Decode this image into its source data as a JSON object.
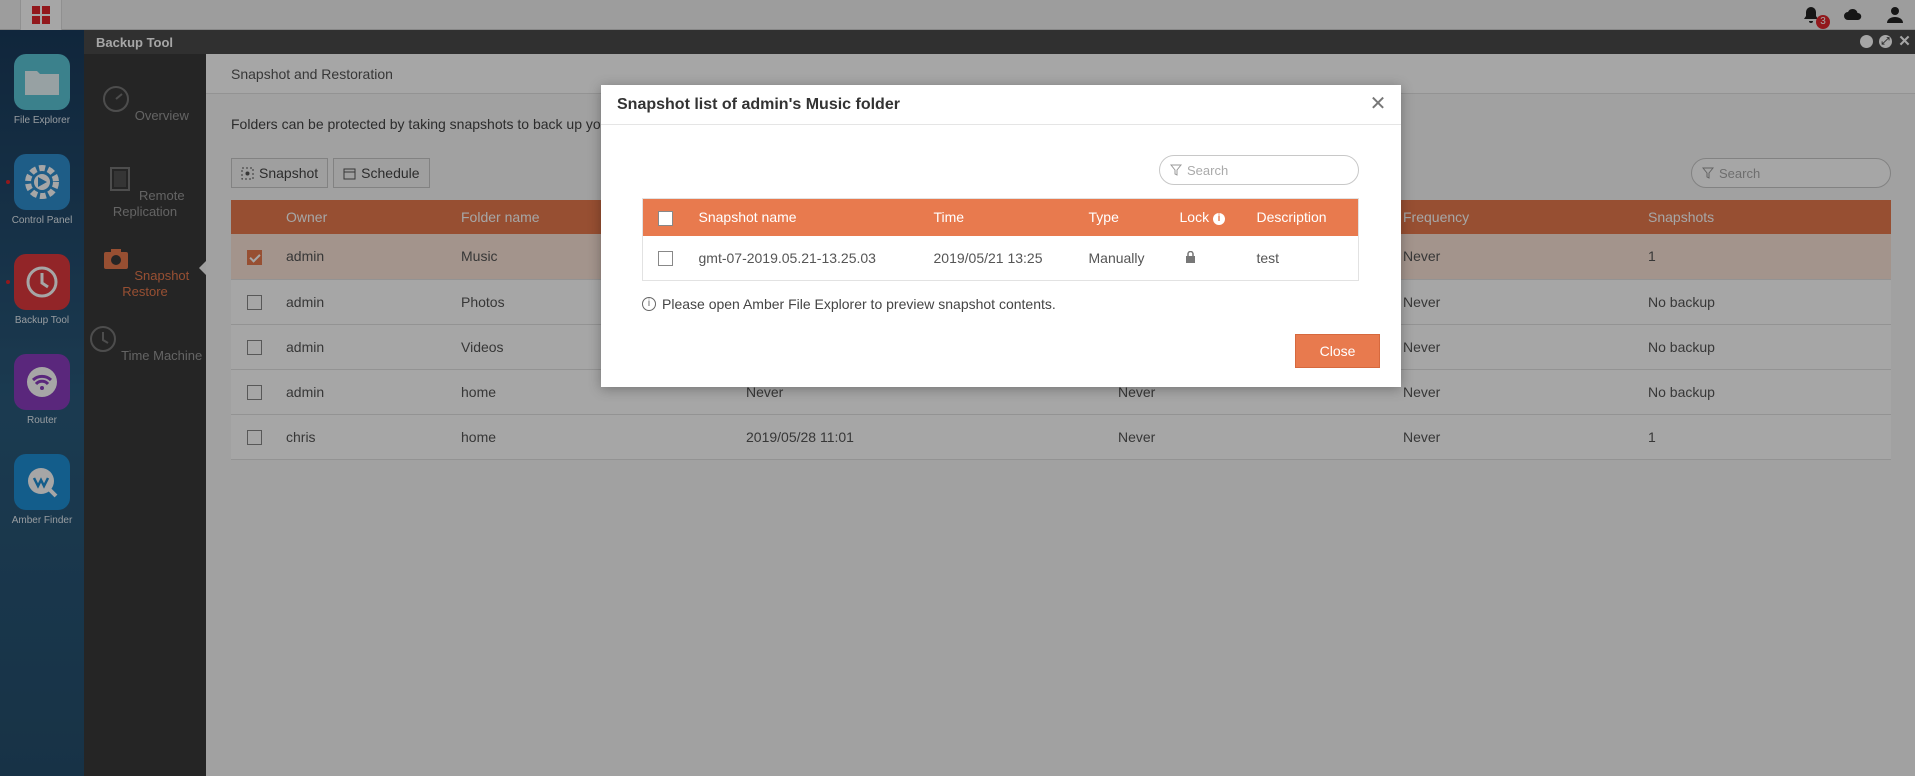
{
  "topbar": {
    "notification_count": "3"
  },
  "dock": [
    {
      "label": "File Explorer",
      "color": "#5bc6d8"
    },
    {
      "label": "Control Panel",
      "color": "#2f8fd0"
    },
    {
      "label": "Backup Tool",
      "color": "#e0393e"
    },
    {
      "label": "Router",
      "color": "#8a3dbf"
    },
    {
      "label": "Amber Finder",
      "color": "#1e8fd6"
    }
  ],
  "window": {
    "title": "Backup Tool"
  },
  "sidebar": [
    {
      "label": "Overview"
    },
    {
      "label": "Remote Replication"
    },
    {
      "label": "Snapshot Restore"
    },
    {
      "label": "Time Machine"
    }
  ],
  "content": {
    "breadcrumb": "Snapshot and Restoration",
    "intro": "Folders can be protected by taking snapshots to back up your",
    "snapshot_button": "Snapshot",
    "schedule_button": "Schedule",
    "search_placeholder": "Search",
    "columns": [
      "Owner",
      "Folder name",
      "Frequency",
      "Snapshots"
    ],
    "rows": [
      {
        "owner": "admin",
        "folder": "Music",
        "last": "",
        "type": "",
        "frequency": "Never",
        "snapshots": "1"
      },
      {
        "owner": "admin",
        "folder": "Photos",
        "last": "",
        "type": "",
        "frequency": "Never",
        "snapshots": "No backup"
      },
      {
        "owner": "admin",
        "folder": "Videos",
        "last": "",
        "type": "",
        "frequency": "Never",
        "snapshots": "No backup"
      },
      {
        "owner": "admin",
        "folder": "home",
        "last": "Never",
        "type": "Never",
        "frequency": "Never",
        "snapshots": "No backup"
      },
      {
        "owner": "chris",
        "folder": "home",
        "last": "2019/05/28 11:01",
        "type": "Never",
        "frequency": "Never",
        "snapshots": "1"
      }
    ]
  },
  "dialog": {
    "title": "Snapshot list of admin's Music folder",
    "search_placeholder": "Search",
    "columns": {
      "name": "Snapshot name",
      "time": "Time",
      "type": "Type",
      "lock": "Lock",
      "description": "Description"
    },
    "rows": [
      {
        "name": "gmt-07-2019.05.21-13.25.03",
        "time": "2019/05/21 13:25",
        "type": "Manually",
        "description": "test"
      }
    ],
    "hint": "Please open Amber File Explorer to preview snapshot contents.",
    "close_label": "Close"
  },
  "colors": {
    "accent": "#e87a4e",
    "sidebar_bg": "#3a3a3a",
    "titlebar_bg": "#4a4a4a"
  }
}
